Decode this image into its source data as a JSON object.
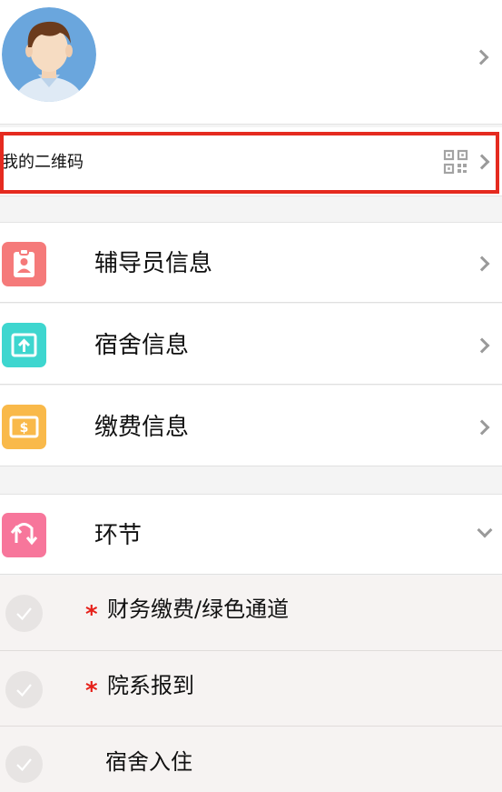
{
  "profile": {
    "avatar_icon": "user-avatar-icon"
  },
  "qr": {
    "label": "我的二维码",
    "icon": "qr-code-icon",
    "highlight_color": "#e52a1f"
  },
  "menu": [
    {
      "label": "辅导员信息",
      "icon": "badge-icon",
      "color": "#f57a7a"
    },
    {
      "label": "宿舍信息",
      "icon": "upload-box-icon",
      "color": "#3ed6cf"
    },
    {
      "label": "缴费信息",
      "icon": "money-icon",
      "color": "#f9b94a"
    }
  ],
  "stages": {
    "label": "环节",
    "icon": "swap-arrows-icon",
    "color": "#f7769b"
  },
  "steps": [
    {
      "label": "财务缴费/绿色通道",
      "required_mark": "*"
    },
    {
      "label": "院系报到",
      "required_mark": "*"
    },
    {
      "label": "宿舍入住",
      "required_mark": ""
    }
  ],
  "colors": {
    "chevron": "#9a9a9a",
    "required_star": "#e6201a",
    "step_background": "#f6f3f2"
  }
}
